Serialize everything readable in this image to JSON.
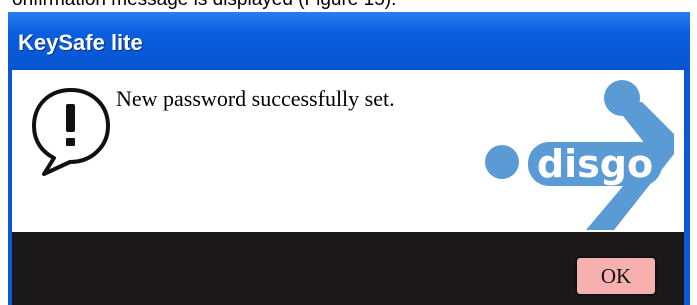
{
  "document": {
    "caption": "onfirmation message is displayed (Figure 15)."
  },
  "dialog": {
    "title": "KeySafe lite",
    "message": "New password successfully set.",
    "icon": "exclamation-speech-bubble-icon",
    "logo": {
      "text": "disgo",
      "color": "#5b9bd5"
    },
    "ok_label": "OK"
  },
  "colors": {
    "title_bar": "#0a5fe0",
    "button_bar": "#1b1819",
    "ok_button": "#f7b0b0"
  }
}
